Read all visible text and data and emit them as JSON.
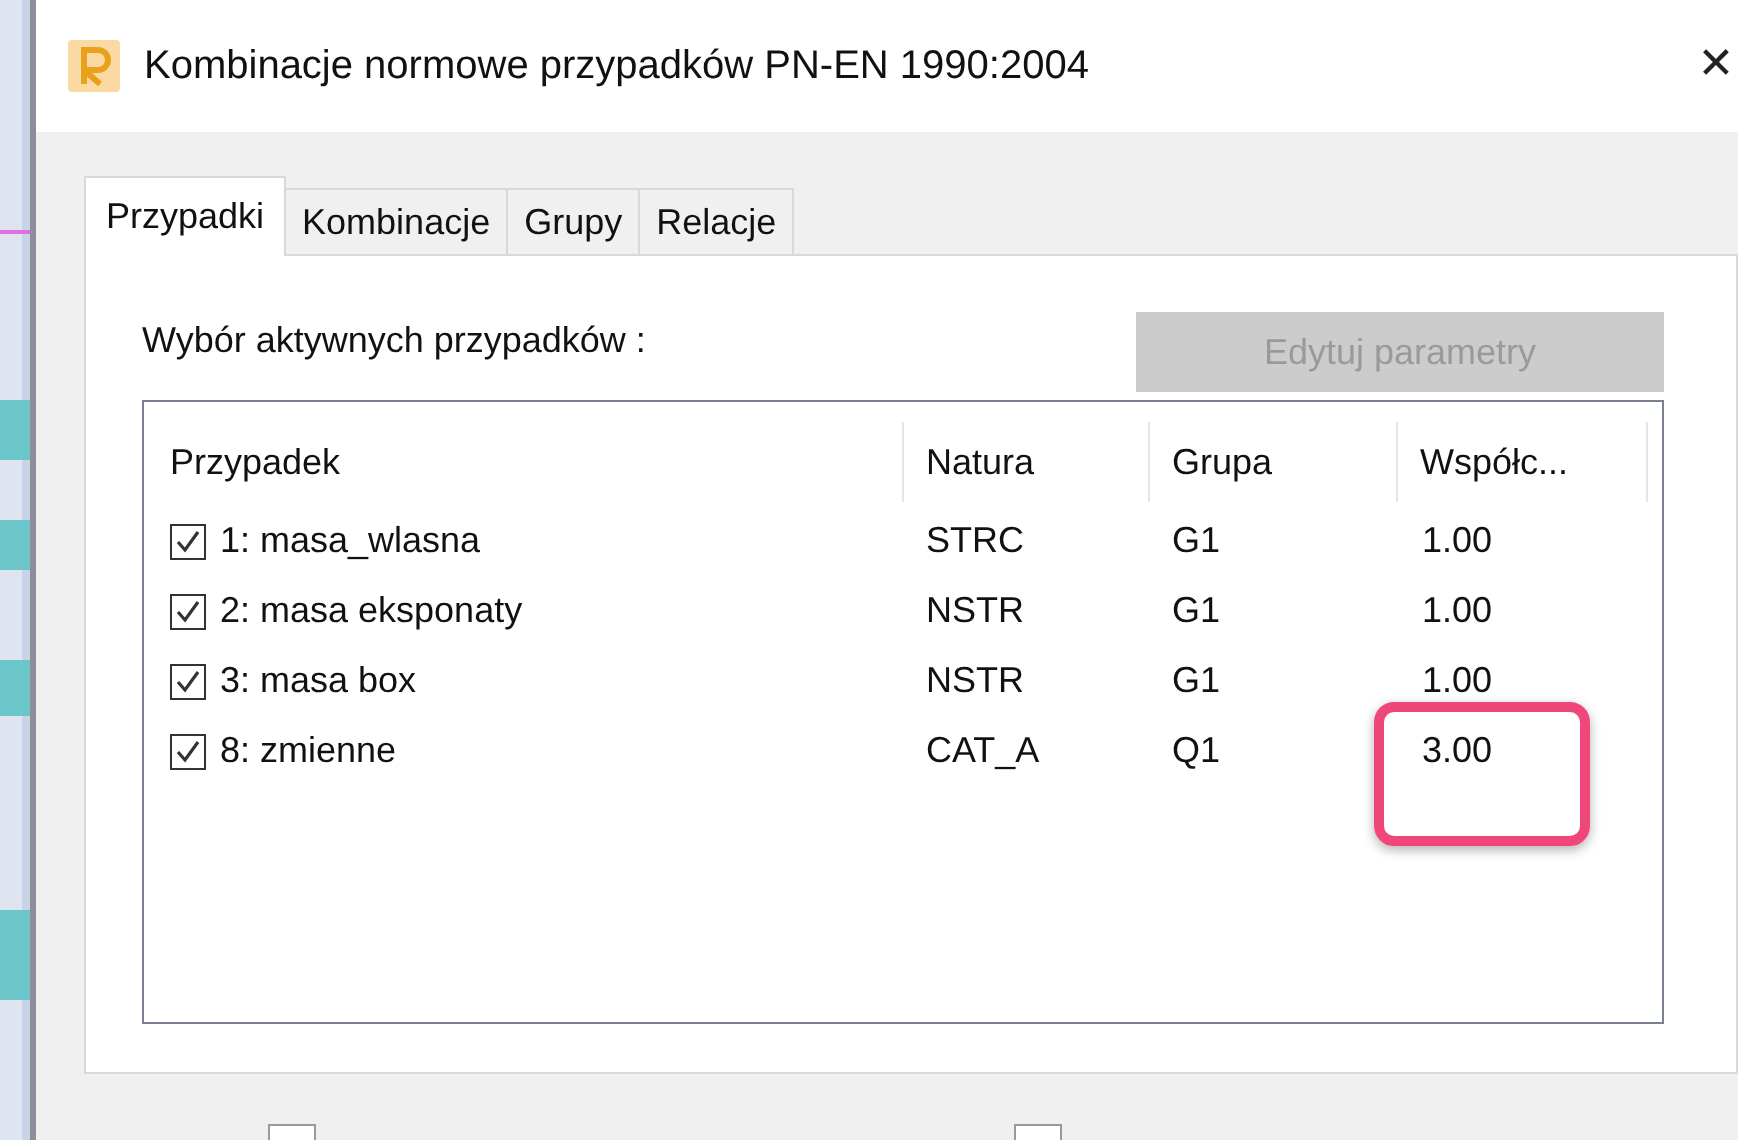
{
  "window": {
    "title": "Kombinacje normowe przypadków PN-EN 1990:2004",
    "close": "✕"
  },
  "tabs": [
    {
      "label": "Przypadki",
      "selected": true
    },
    {
      "label": "Kombinacje",
      "selected": false
    },
    {
      "label": "Grupy",
      "selected": false
    },
    {
      "label": "Relacje",
      "selected": false
    }
  ],
  "section_label": "Wybór aktywnych przypadków :",
  "edit_button": {
    "label": "Edytuj parametry",
    "disabled": true
  },
  "table": {
    "columns": [
      "Przypadek",
      "Natura",
      "Grupa",
      "Współc..."
    ],
    "rows": [
      {
        "checked": true,
        "cells": [
          "1: masa_wlasna",
          "STRC",
          "G1",
          "1.00"
        ]
      },
      {
        "checked": true,
        "cells": [
          "2: masa eksponaty",
          "NSTR",
          "G1",
          "1.00"
        ]
      },
      {
        "checked": true,
        "cells": [
          "3: masa box",
          "NSTR",
          "G1",
          "1.00"
        ]
      },
      {
        "checked": true,
        "cells": [
          "8: zmienne",
          "CAT_A",
          "Q1",
          "3.00"
        ]
      }
    ]
  },
  "bottom_checkboxes": [
    {
      "checked": false
    },
    {
      "checked": false
    }
  ]
}
